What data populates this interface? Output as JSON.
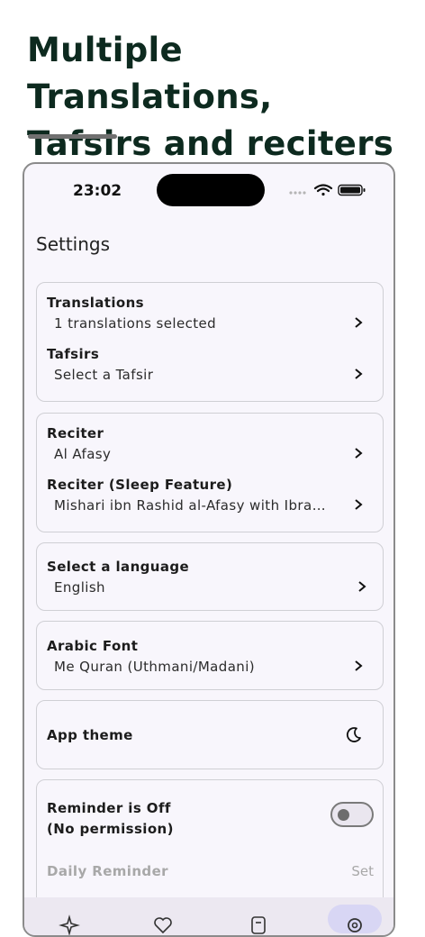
{
  "promo": {
    "headline_line1": "Multiple Translations,",
    "headline_line2": "Tafsirs and reciters"
  },
  "status_bar": {
    "time": "23:02",
    "icons": [
      "signal-dots-icon",
      "wifi-icon",
      "battery-icon"
    ]
  },
  "page": {
    "title": "Settings"
  },
  "cards": {
    "translations": {
      "title": "Translations",
      "subtitle": "1 translations selected"
    },
    "tafsirs": {
      "title": "Tafsirs",
      "subtitle": "Select a Tafsir"
    },
    "reciter": {
      "title": "Reciter",
      "subtitle": "Al Afasy"
    },
    "reciter_sleep": {
      "title": "Reciter (Sleep Feature)",
      "subtitle": "Mishari ibn Rashid al-Afasy with Ibrahim Walk"
    },
    "language": {
      "title": "Select a language",
      "subtitle": "English"
    },
    "arabic_font": {
      "title": "Arabic Font",
      "subtitle": "Me Quran (Uthmani/Madani)"
    },
    "theme": {
      "title": "App theme",
      "icon": "moon-icon"
    },
    "reminder": {
      "title_line1": "Reminder is Off",
      "title_line2": "(No permission)",
      "toggle_on": false,
      "daily_label": "Daily Reminder",
      "set_label": "Set"
    }
  },
  "bottom_nav": {
    "items": [
      "sparkle-icon",
      "heart-icon",
      "bookmark-icon",
      "settings-icon"
    ],
    "active": "settings-icon"
  },
  "colors": {
    "headline": "#0d2a1f",
    "screen_bg": "#f8f6fc",
    "card_border": "#cfcfd4",
    "nav_bg": "#ece8f1",
    "nav_active": "#d8d6f4"
  }
}
